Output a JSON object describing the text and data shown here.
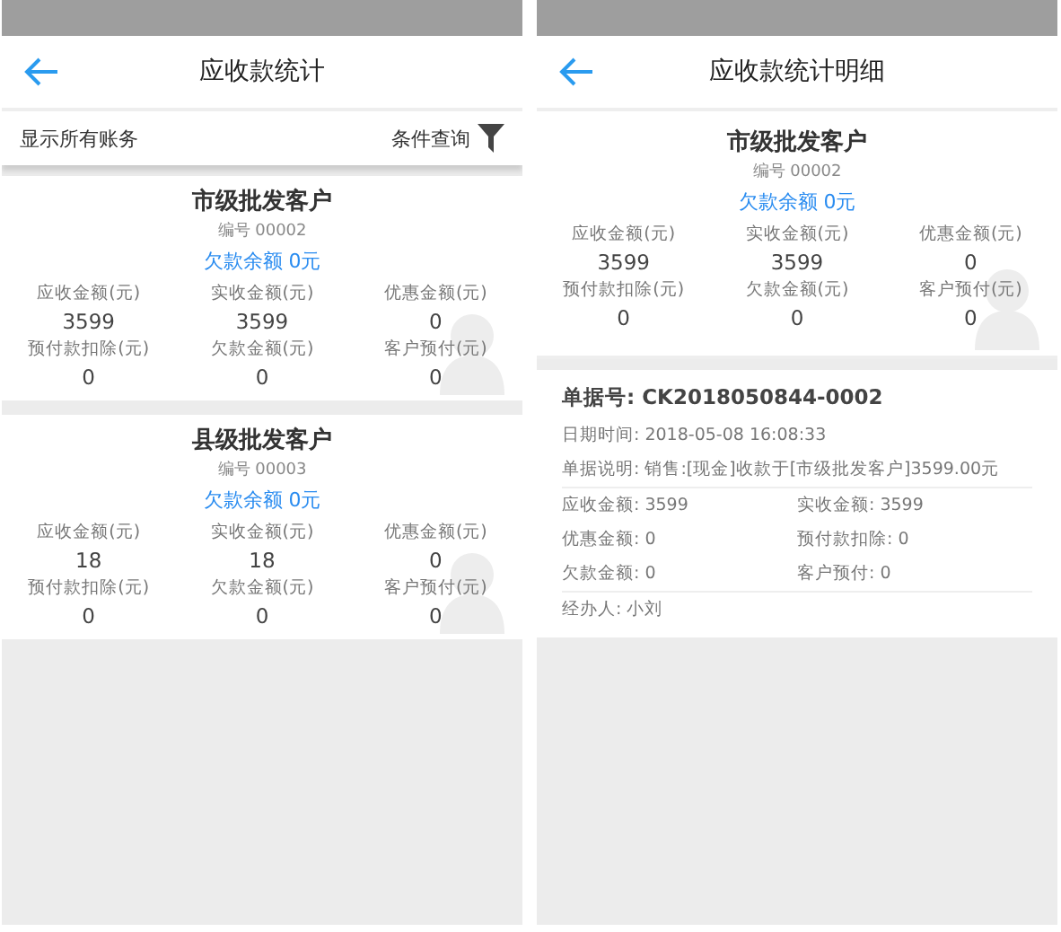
{
  "summary_screen": {
    "title": "应收款统计",
    "filter_label": "显示所有账务",
    "query_label": "条件查询",
    "customers": [
      {
        "name": "市级批发客户",
        "code": "编号 00002",
        "balance": "欠款余额  0元",
        "stats": [
          {
            "label": "应收金额(元)",
            "value": "3599"
          },
          {
            "label": "实收金额(元)",
            "value": "3599"
          },
          {
            "label": "优惠金额(元)",
            "value": "0"
          },
          {
            "label": "预付款扣除(元)",
            "value": "0"
          },
          {
            "label": "欠款金额(元)",
            "value": "0"
          },
          {
            "label": "客户预付(元)",
            "value": "0"
          }
        ]
      },
      {
        "name": "县级批发客户",
        "code": "编号 00003",
        "balance": "欠款余额  0元",
        "stats": [
          {
            "label": "应收金额(元)",
            "value": "18"
          },
          {
            "label": "实收金额(元)",
            "value": "18"
          },
          {
            "label": "优惠金额(元)",
            "value": "0"
          },
          {
            "label": "预付款扣除(元)",
            "value": "0"
          },
          {
            "label": "欠款金额(元)",
            "value": "0"
          },
          {
            "label": "客户预付(元)",
            "value": "0"
          }
        ]
      }
    ]
  },
  "detail_screen": {
    "title": "应收款统计明细",
    "customer": {
      "name": "市级批发客户",
      "code": "编号 00002",
      "balance": "欠款余额  0元",
      "stats": [
        {
          "label": "应收金额(元)",
          "value": "3599"
        },
        {
          "label": "实收金额(元)",
          "value": "3599"
        },
        {
          "label": "优惠金额(元)",
          "value": "0"
        },
        {
          "label": "预付款扣除(元)",
          "value": "0"
        },
        {
          "label": "欠款金额(元)",
          "value": "0"
        },
        {
          "label": "客户预付(元)",
          "value": "0"
        }
      ]
    },
    "document": {
      "number": "单据号: CK2018050844-0002",
      "lines": [
        "日期时间: 2018-05-08 16:08:33",
        "单据说明: 销售:[现金]收款于[市级批发客户]3599.00元"
      ],
      "amounts": [
        "应收金额: 3599",
        "实收金额: 3599",
        "优惠金额: 0",
        "预付款扣除:  0",
        "欠款金额: 0",
        "客户预付: 0"
      ],
      "handler": "经办人: 小刘"
    }
  }
}
